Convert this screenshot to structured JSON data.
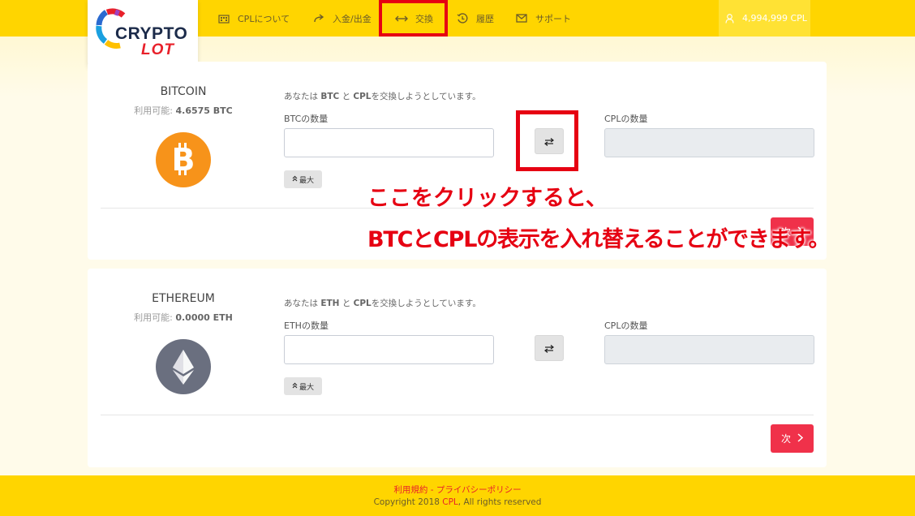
{
  "header": {
    "logo_top": "CRYPTO",
    "logo_bottom": "LOT",
    "nav": [
      {
        "label": "CPLについて",
        "icon": "building-icon"
      },
      {
        "label": "入金/出金",
        "icon": "redo-arrow-icon"
      },
      {
        "label": "交換",
        "icon": "swap-arrows-icon"
      },
      {
        "label": "履歴",
        "icon": "history-icon"
      },
      {
        "label": "サポート",
        "icon": "mail-icon"
      }
    ],
    "balance": "4,994,999 CPL"
  },
  "cards": [
    {
      "name": "BITCOIN",
      "available_label": "利用可能:",
      "available_value": "4.6575 BTC",
      "desc_pre": "あなたは",
      "desc_coin": "BTC",
      "desc_mid": "と",
      "desc_cpl": "CPL",
      "desc_post": "を交換しようとしています。",
      "coin_label": "BTCの数量",
      "cpl_label": "CPLの数量",
      "max_label": "最大",
      "next_label": "次",
      "coin_color": "#f7931a"
    },
    {
      "name": "ETHEREUM",
      "available_label": "利用可能:",
      "available_value": "0.0000 ETH",
      "desc_pre": "あなたは",
      "desc_coin": "ETH",
      "desc_mid": "と",
      "desc_cpl": "CPL",
      "desc_post": "を交換しようとしています。",
      "coin_label": "ETHの数量",
      "cpl_label": "CPLの数量",
      "max_label": "最大",
      "next_label": "次",
      "coin_color": "#6a6f7f"
    }
  ],
  "annotation": {
    "line1": "ここをクリックすると、",
    "line2": "BTCとCPLの表示を入れ替えることができます。"
  },
  "footer": {
    "terms": "利用規約",
    "sep": " - ",
    "privacy": "プライバシーポリシー",
    "copy_pre": "Copyright 2018 ",
    "copy_brand": "CPL",
    "copy_post": ", All rights reserved"
  }
}
